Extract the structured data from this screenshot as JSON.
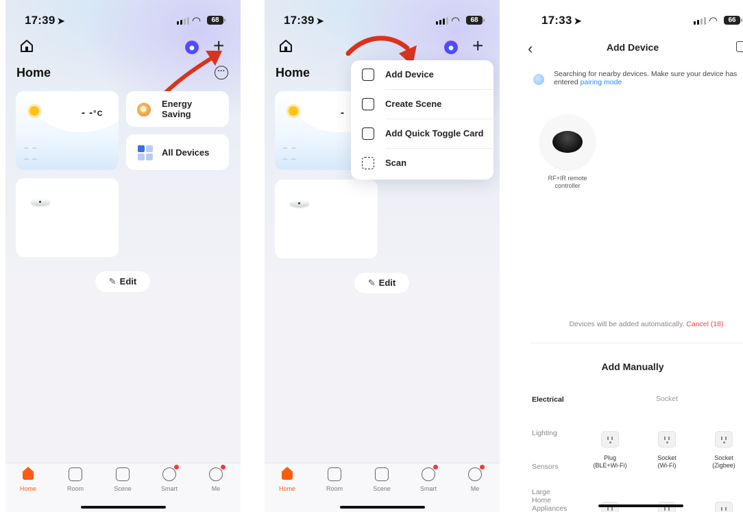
{
  "panel1": {
    "status": {
      "time": "17:39",
      "battery": "68"
    },
    "home_title": "Home",
    "weather": {
      "temp": "- -",
      "unit": "°C",
      "dash1": "– –",
      "dash2": "– –"
    },
    "energy_card": {
      "label_line1": "Energy",
      "label_line2": "Saving"
    },
    "all_devices_card": {
      "label": "All Devices"
    },
    "edit_button": {
      "label": "Edit"
    },
    "tabs": [
      {
        "label": "Home",
        "icon": "home-icon",
        "active": true
      },
      {
        "label": "Room",
        "icon": "room-icon"
      },
      {
        "label": "Scene",
        "icon": "scene-icon"
      },
      {
        "label": "Smart",
        "icon": "smart-icon",
        "badge": true
      },
      {
        "label": "Me",
        "icon": "me-icon",
        "badge": true
      }
    ]
  },
  "panel2": {
    "status": {
      "time": "17:39",
      "battery": "68"
    },
    "home_title": "Home",
    "weather": {
      "temp": "-",
      "dash1": "– –",
      "dash2": "– –"
    },
    "menu": {
      "items": [
        {
          "label": "Add Device",
          "icon": "add-device-icon"
        },
        {
          "label": "Create Scene",
          "icon": "create-scene-icon"
        },
        {
          "label": "Add Quick Toggle Card",
          "icon": "quick-toggle-icon"
        },
        {
          "label": "Scan",
          "icon": "scan-icon"
        }
      ]
    },
    "edit_button": {
      "label": "Edit"
    },
    "tabs": [
      {
        "label": "Home",
        "active": true
      },
      {
        "label": "Room"
      },
      {
        "label": "Scene"
      },
      {
        "label": "Smart",
        "badge": true
      },
      {
        "label": "Me",
        "badge": true
      }
    ]
  },
  "panel3": {
    "status": {
      "time": "17:33",
      "battery": "66"
    },
    "title": "Add Device",
    "search": {
      "text": "Searching for nearby devices. Make sure your device has entered",
      "link": "pairing mode"
    },
    "found_device": {
      "label_line1": "RF+IR remote",
      "label_line2": "controller"
    },
    "auto_add": {
      "text": "Devices will be added automatically.",
      "cancel": "Cancel (18)"
    },
    "manual_title": "Add Manually",
    "categories": [
      "Electrical",
      "Lighting",
      "Sensors",
      "Large",
      "Home",
      "Appliances"
    ],
    "subheading": "Socket",
    "sockets": [
      {
        "line1": "Plug",
        "line2": "(BLE+Wi-Fi)"
      },
      {
        "line1": "Socket",
        "line2": "(Wi-Fi)"
      },
      {
        "line1": "Socket",
        "line2": "(Zigbee)"
      }
    ]
  },
  "colors": {
    "accent": "#ff5a12",
    "arrow": "#e0301e",
    "link": "#1a8cff",
    "cancel": "#ef4444"
  }
}
